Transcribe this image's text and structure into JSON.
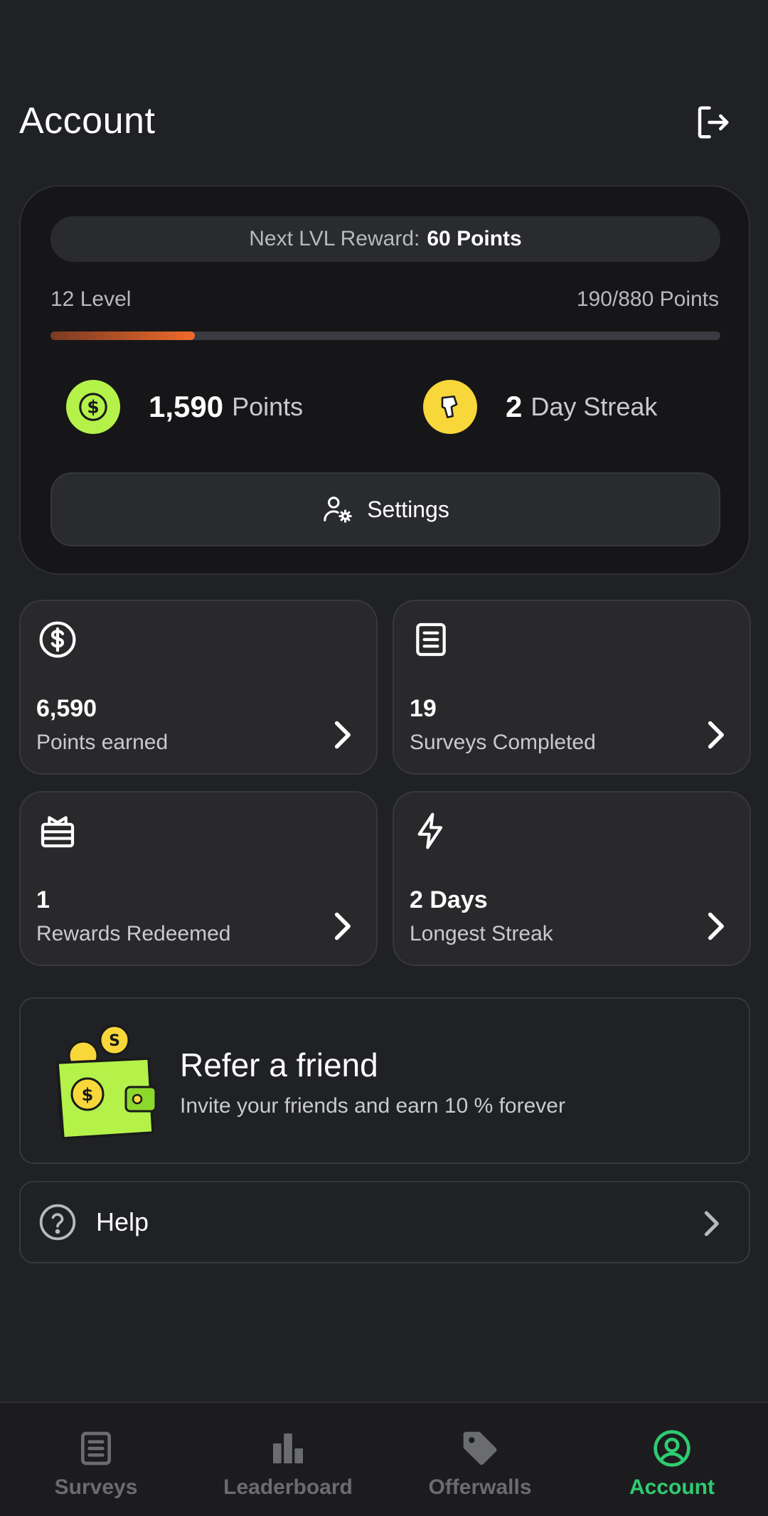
{
  "header": {
    "title": "Account",
    "logout_icon": "logout-icon"
  },
  "level_card": {
    "reward_label": "Next LVL Reward:",
    "reward_value": "60 Points",
    "level_label": "12 Level",
    "points_progress": "190/880 Points",
    "progress_fraction": 0.216,
    "points_value": "1,590",
    "points_unit": "Points",
    "streak_value": "2",
    "streak_unit": "Day Streak",
    "settings_label": "Settings"
  },
  "stats": [
    {
      "value": "6,590",
      "caption": "Points earned",
      "icon": "dollar-circle-icon"
    },
    {
      "value": "19",
      "caption": "Surveys Completed",
      "icon": "document-icon"
    },
    {
      "value": "1",
      "caption": "Rewards Redeemed",
      "icon": "gift-icon"
    },
    {
      "value": "2 Days",
      "caption": "Longest Streak",
      "icon": "lightning-icon"
    }
  ],
  "refer": {
    "title": "Refer a friend",
    "subtitle": "Invite your friends and earn 10 % forever"
  },
  "help": {
    "label": "Help"
  },
  "nav": {
    "items": [
      {
        "label": "Surveys"
      },
      {
        "label": "Leaderboard"
      },
      {
        "label": "Offerwalls"
      },
      {
        "label": "Account"
      }
    ],
    "active": "Account"
  },
  "colors": {
    "background": "#202124",
    "accent_green": "#2ecc71",
    "progress": "#f06a2b",
    "coin_green": "#b4f24a",
    "coin_yellow": "#f8d73a"
  }
}
